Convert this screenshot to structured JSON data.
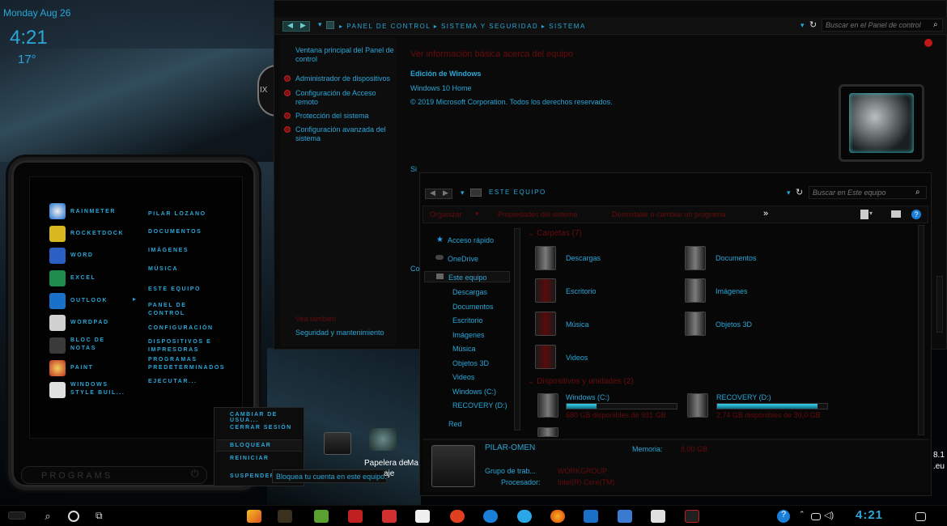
{
  "desktop": {
    "date": "Monday Aug 26",
    "time": "4:21",
    "temperature": "17°",
    "clock_numeral": "IX",
    "icons": [
      {
        "label": "Papelera de"
      },
      {
        "label": "aje"
      },
      {
        "label": "Ma"
      }
    ],
    "edge_text": [
      "8.1",
      ".eu"
    ]
  },
  "control_panel": {
    "breadcrumb": [
      "Panel de control",
      "Sistema y seguridad",
      "Sistema"
    ],
    "search_placeholder": "Buscar en el Panel de control",
    "sidebar": {
      "home": "Ventana principal del Panel de control",
      "links": [
        "Administrador de dispositivos",
        "Configuración de Acceso remoto",
        "Protección del sistema",
        "Configuración avanzada del sistema"
      ],
      "see_also": "Vea también",
      "security": "Seguridad y mantenimiento"
    },
    "title": "Ver información básica acerca del equipo",
    "edition_heading": "Edición de Windows",
    "edition": "Windows 10 Home",
    "copyright": "© 2019 Microsoft Corporation. Todos los derechos reservados.",
    "clipped_labels": [
      "Si",
      "Co"
    ]
  },
  "explorer": {
    "location": "Este equipo",
    "search_placeholder": "Buscar en Este equipo",
    "toolbar": [
      "Organizar",
      "Propiedades del sistema",
      "Desinstalar o cambiar un programa"
    ],
    "more": "»",
    "nav": [
      {
        "label": "Acceso rápido"
      },
      {
        "label": "OneDrive"
      },
      {
        "label": "Este equipo"
      },
      {
        "label": "Descargas"
      },
      {
        "label": "Documentos"
      },
      {
        "label": "Escritorio"
      },
      {
        "label": "Imágenes"
      },
      {
        "label": "Música"
      },
      {
        "label": "Objetos 3D"
      },
      {
        "label": "Videos"
      },
      {
        "label": "Windows (C:)"
      },
      {
        "label": "RECOVERY (D:)"
      },
      {
        "label": "Red"
      }
    ],
    "folders_heading": "Carpetas (7)",
    "folders": [
      "Descargas",
      "Documentos",
      "Escritorio",
      "Imágenes",
      "Música",
      "Objetos 3D",
      "Videos"
    ],
    "devices_heading": "Dispositivos y unidades (2)",
    "drives": [
      {
        "name": "Windows (C:)",
        "free": "680 GB disponibles de 931 GB",
        "fill_pct": 27
      },
      {
        "name": "RECOVERY (D:)",
        "free": "2,74 GB disponibles de 30,0 GB",
        "fill_pct": 91
      }
    ],
    "details": {
      "computer": "PILAR-OMEN",
      "memory_label": "Memoria:",
      "memory_value": "8,00 GB",
      "workgroup_label": "Grupo de trab...",
      "workgroup_value": "WORKGROUP",
      "processor_label": "Procesador:",
      "processor_value": "Intel(R) Core(TM)"
    }
  },
  "start_menu": {
    "left_items": [
      "Rainmeter",
      "RocketDock",
      "Word",
      "Excel",
      "Outlook",
      "WordPad",
      "Bloc de notas",
      "Paint",
      "Windows Style Buil..."
    ],
    "right_items": [
      "Pilar Lozano",
      "Documentos",
      "Imágenes",
      "Música",
      "Este equipo",
      "Panel de control",
      "Configuración",
      "Dispositivos e impresoras",
      "Programas predeterminados",
      "Ejecutar..."
    ],
    "programs": "Programs"
  },
  "power_menu": {
    "items": [
      "Cambiar de usua...",
      "Cerrar sesión",
      "Bloquear",
      "Reiniciar",
      "Suspender"
    ],
    "tooltip": "Bloquea tu cuenta en este equipo."
  },
  "taskbar": {
    "time": "4:21"
  }
}
